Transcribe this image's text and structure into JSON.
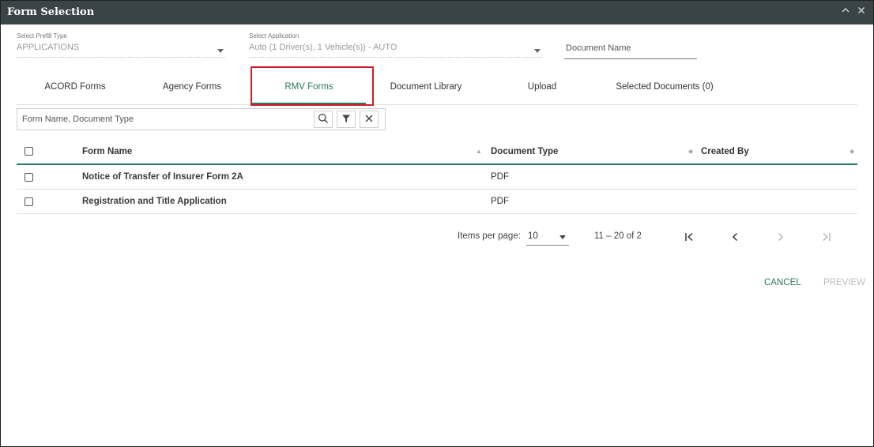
{
  "window": {
    "title": "Form Selection",
    "collapse_icon": "chevron-up-icon",
    "close_icon": "close-icon"
  },
  "filters": {
    "prefill": {
      "label": "Select Prefill Type",
      "value": "APPLICATIONS"
    },
    "application": {
      "label": "Select Application",
      "value": "Auto (1 Driver(s), 1 Vehicle(s)) - AUTO"
    },
    "document_name": {
      "placeholder": "Document Name"
    }
  },
  "tabs": [
    {
      "label": "ACORD Forms",
      "active": false
    },
    {
      "label": "Agency Forms",
      "active": false
    },
    {
      "label": "RMV Forms",
      "active": true
    },
    {
      "label": "Document Library",
      "active": false
    },
    {
      "label": "Upload",
      "active": false
    },
    {
      "label": "Selected Documents (0)",
      "active": false
    }
  ],
  "search": {
    "placeholder": "Form Name, Document Type",
    "icons": [
      "search-icon",
      "filter-icon",
      "clear-icon"
    ]
  },
  "table": {
    "columns": [
      "Form Name",
      "Document Type",
      "Created By"
    ],
    "rows": [
      {
        "name": "Notice of Transfer of Insurer Form 2A",
        "type": "PDF",
        "created_by": ""
      },
      {
        "name": "Registration and Title Application",
        "type": "PDF",
        "created_by": ""
      }
    ]
  },
  "pagination": {
    "items_per_page_label": "Items per page:",
    "items_per_page": "10",
    "range": "11 – 20 of 2"
  },
  "actions": {
    "cancel": "CANCEL",
    "preview": "PREVIEW"
  },
  "colors": {
    "titlebar": "#3a4346",
    "accent": "#2a7a5c",
    "highlight": "#d01f27",
    "disabled": "#bdbdbd"
  }
}
